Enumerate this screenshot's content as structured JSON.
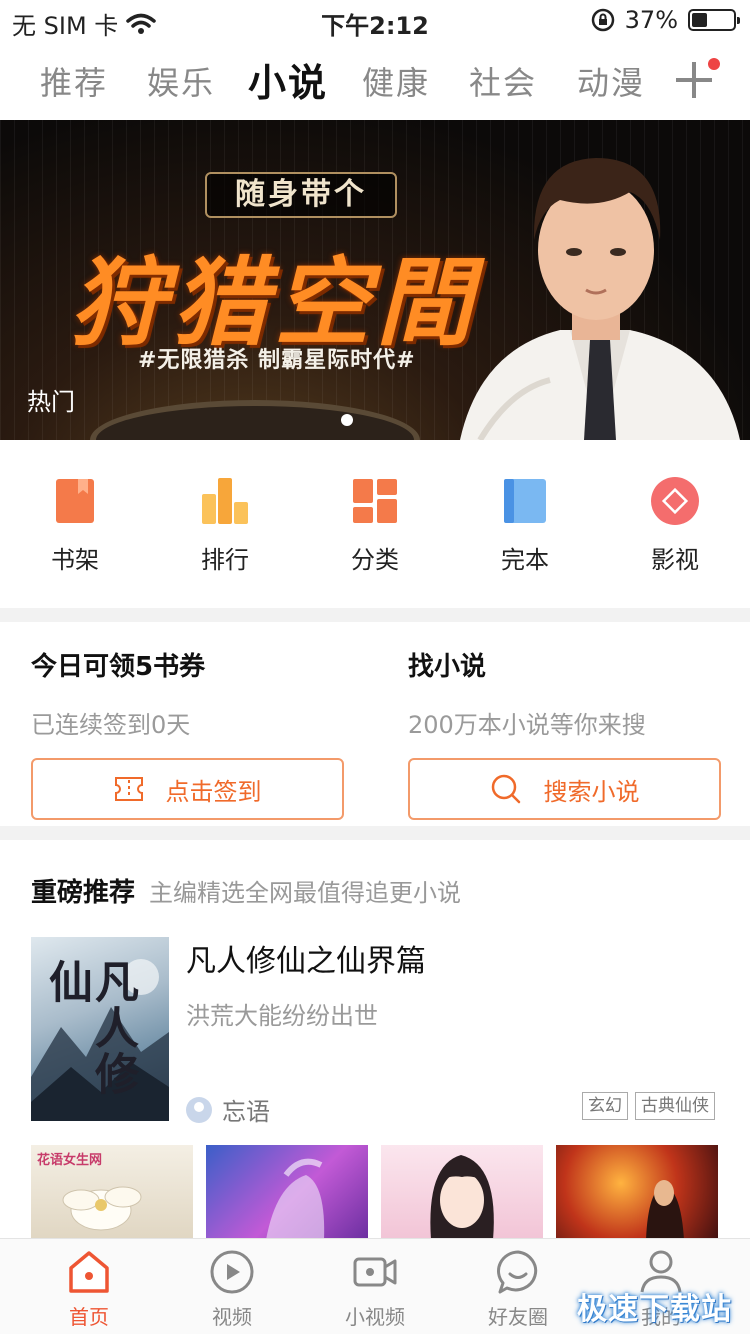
{
  "status_bar": {
    "carrier": "无 SIM 卡",
    "time": "下午2:12",
    "battery": "37%",
    "battery_level": 0.37
  },
  "tabs": [
    "推荐",
    "娱乐",
    "小说",
    "健康",
    "社会",
    "动漫"
  ],
  "active_tab": "小说",
  "banner": {
    "subtitle": "随身带个",
    "title": "狩猎空間",
    "tagline": "#无限猎杀 制霸星际时代#",
    "label": "热门"
  },
  "entries": [
    {
      "label": "书架",
      "icon": "bookshelf-icon"
    },
    {
      "label": "排行",
      "icon": "ranking-icon"
    },
    {
      "label": "分类",
      "icon": "category-icon"
    },
    {
      "label": "完本",
      "icon": "completed-icon"
    },
    {
      "label": "影视",
      "icon": "film-icon"
    }
  ],
  "signin": {
    "title": "今日可领5书券",
    "desc": "已连续签到0天",
    "button": "点击签到"
  },
  "search": {
    "title": "找小说",
    "desc": "200万本小说等你来搜",
    "button": "搜索小说"
  },
  "recommend": {
    "heading": "重磅推荐",
    "subheading": "主编精选全网最值得追更小说",
    "book": {
      "title": "凡人修仙之仙界篇",
      "cover_text": "凡人修仙",
      "desc": "洪荒大能纷纷出世",
      "author": "忘语",
      "tags": [
        "玄幻",
        "古典仙侠"
      ]
    },
    "thumb_text": "花语女生网"
  },
  "bottom_nav": [
    {
      "label": "首页",
      "icon": "home-icon"
    },
    {
      "label": "视频",
      "icon": "video-play-icon"
    },
    {
      "label": "小视频",
      "icon": "video-camera-icon"
    },
    {
      "label": "好友圈",
      "icon": "chat-bubble-icon"
    },
    {
      "label": "我的",
      "icon": "user-icon"
    }
  ],
  "watermark": "极速下载站",
  "colors": {
    "accent": "#f06a2a",
    "active_nav": "#ee5533",
    "banner_title": "#ff8c24"
  }
}
